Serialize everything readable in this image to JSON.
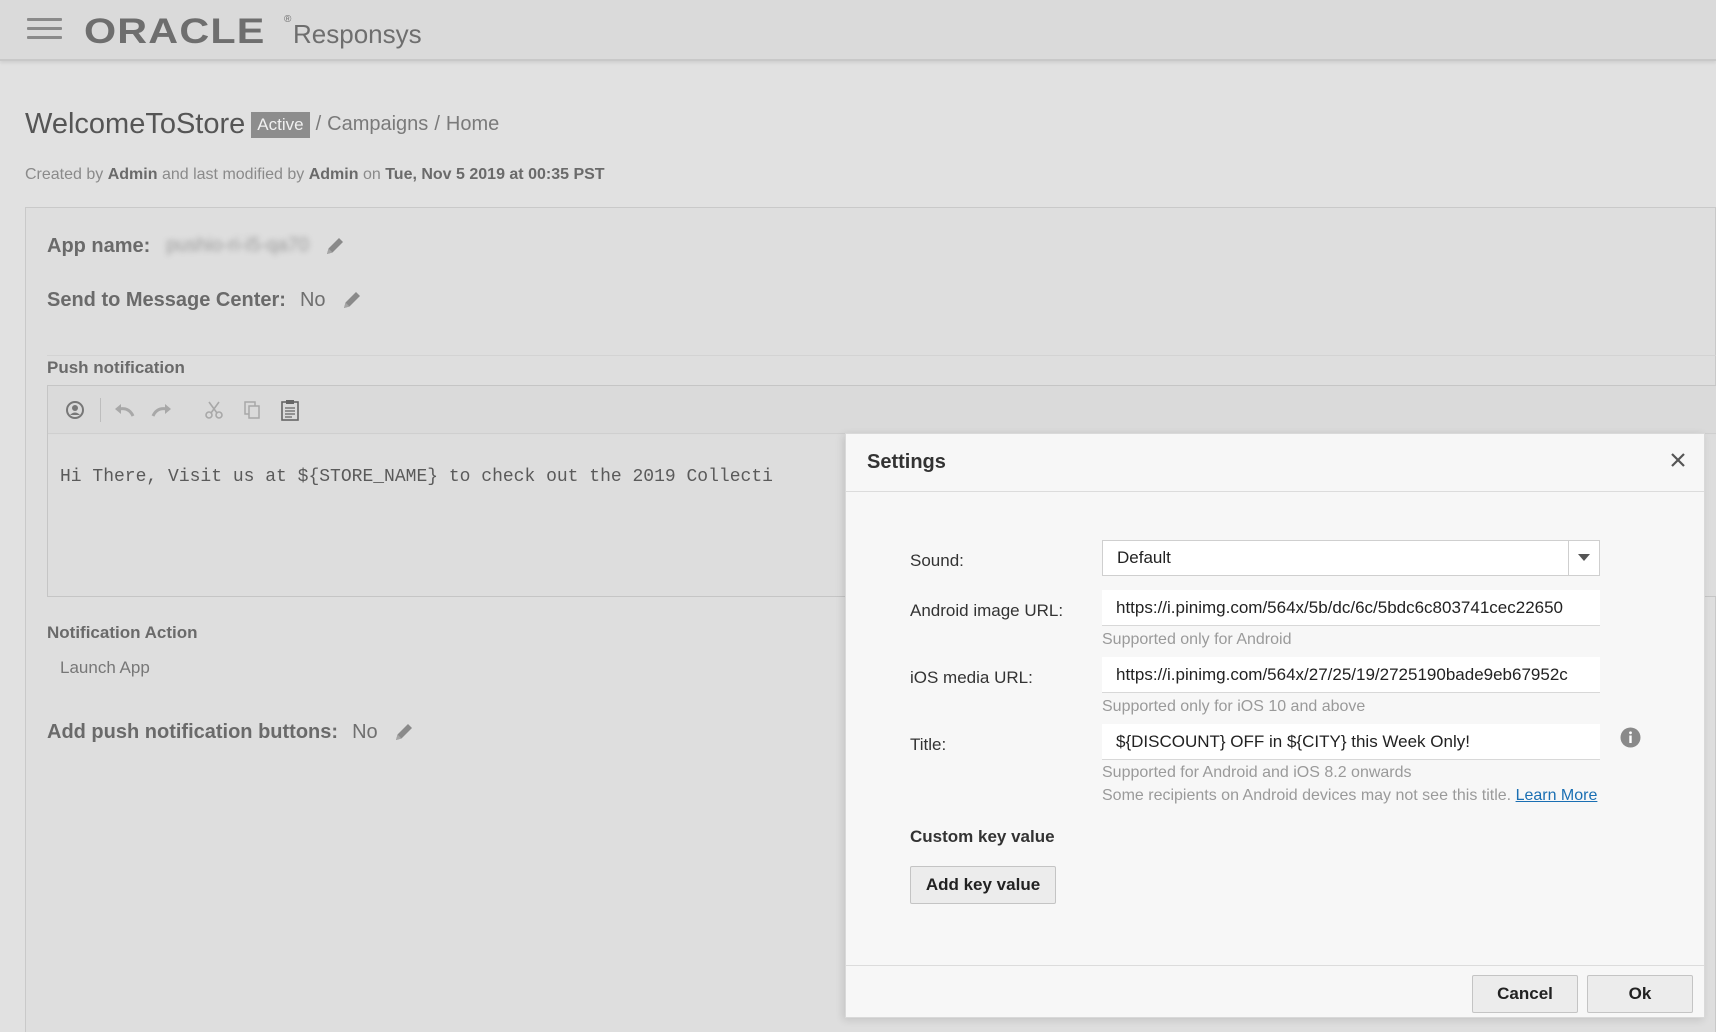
{
  "topbar": {
    "brand": "ORACLE",
    "brand_mark": "®",
    "product": "Responsys",
    "menu_icon": "hamburger-menu-icon"
  },
  "header": {
    "title": "WelcomeToStore",
    "status": "Active",
    "breadcrumb": [
      "Campaigns",
      "Home"
    ],
    "meta": {
      "created_by_prefix": "Created by",
      "created_by": "Admin",
      "modified_by_prefix": "and last modified by",
      "modified_by": "Admin",
      "on_prefix": "on",
      "modified_at": "Tue, Nov 5 2019 at 00:35 PST"
    }
  },
  "main": {
    "app_name_label": "App name:",
    "app_name_value": "pushio-ri-i5-qa70",
    "message_center_label": "Send to Message Center:",
    "message_center_value": "No",
    "push_notification_label": "Push notification",
    "editor_toolbar": [
      "personalize-icon",
      "undo-icon",
      "redo-icon",
      "cut-icon",
      "copy-icon",
      "paste-icon"
    ],
    "editor_text": "Hi There, Visit us at ${STORE_NAME} to check out the 2019 Collecti",
    "notification_action_label": "Notification Action",
    "notification_action_value": "Launch App",
    "push_buttons_label": "Add push notification buttons:",
    "push_buttons_value": "No"
  },
  "dialog": {
    "title": "Settings",
    "close_icon": "close-icon",
    "sound_label": "Sound:",
    "sound_value": "Default",
    "android_label": "Android image URL:",
    "android_value": "https://i.pinimg.com/564x/5b/dc/6c/5bdc6c803741cec22650",
    "android_hint": "Supported only for Android",
    "ios_label": "iOS media URL:",
    "ios_value": "https://i.pinimg.com/564x/27/25/19/2725190bade9eb67952c",
    "ios_hint": "Supported only for iOS 10 and above",
    "title_label": "Title:",
    "title_value": "${DISCOUNT} OFF in ${CITY} this Week Only!",
    "title_hint1": "Supported for Android and iOS 8.2 onwards",
    "title_hint2": "Some recipients on Android devices may not see this title.",
    "learn_more": "Learn More",
    "custom_kv_label": "Custom key value",
    "add_kv_button": "Add key value",
    "cancel_button": "Cancel",
    "ok_button": "Ok"
  }
}
